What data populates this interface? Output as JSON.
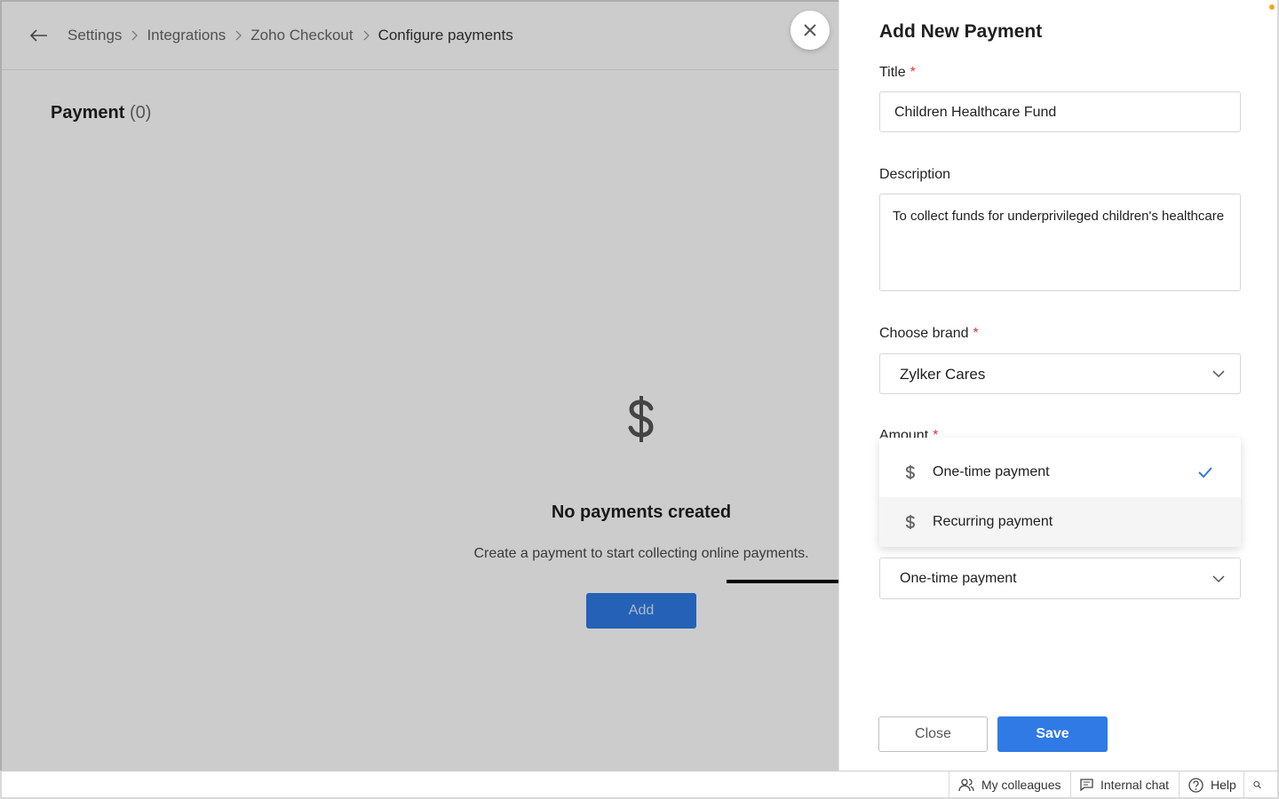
{
  "breadcrumb": [
    "Settings",
    "Integrations",
    "Zoho Checkout",
    "Configure payments"
  ],
  "page": {
    "heading": "Payment",
    "count": "(0)",
    "empty_title": "No payments created",
    "empty_text": "Create a payment to start collecting online payments.",
    "add_label": "Add"
  },
  "panel": {
    "title": "Add New Payment",
    "title_label": "Title",
    "title_value": "Children Healthcare Fund",
    "description_label": "Description",
    "description_value": "To collect funds for underprivileged children's healthcare",
    "brand_label": "Choose brand",
    "brand_value": "Zylker Cares",
    "amount_label": "Amount",
    "payment_type_value": "One-time payment",
    "dropdown": [
      {
        "label": "One-time payment",
        "selected": true
      },
      {
        "label": "Recurring payment",
        "selected": false
      }
    ],
    "close_label": "Close",
    "save_label": "Save"
  },
  "bottombar": {
    "colleagues": "My colleagues",
    "chat": "Internal chat",
    "help": "Help"
  },
  "colors": {
    "accent": "#2f7ae5",
    "required": "#e0362b"
  }
}
